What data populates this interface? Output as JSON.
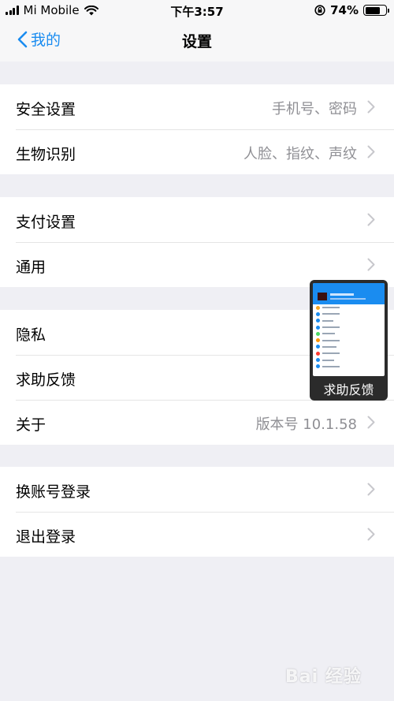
{
  "status_bar": {
    "carrier": "Mi Mobile",
    "time": "下午3:57",
    "battery_percent": "74%",
    "battery_level": 0.74,
    "icons": [
      "signal-bars-icon",
      "wifi-icon",
      "orientation-lock-icon",
      "battery-icon"
    ]
  },
  "nav": {
    "back_label": "我的",
    "title": "设置",
    "accent_color": "#1a8cf0"
  },
  "groups": [
    {
      "rows": [
        {
          "label": "安全设置",
          "value": "手机号、密码"
        },
        {
          "label": "生物识别",
          "value": "人脸、指纹、声纹"
        }
      ]
    },
    {
      "rows": [
        {
          "label": "支付设置",
          "value": ""
        },
        {
          "label": "通用",
          "value": ""
        }
      ]
    },
    {
      "rows": [
        {
          "label": "隐私",
          "value": ""
        },
        {
          "label": "求助反馈",
          "value": ""
        },
        {
          "label": "关于",
          "value": "版本号 10.1.58"
        }
      ]
    },
    {
      "rows": [
        {
          "label": "换账号登录",
          "value": ""
        },
        {
          "label": "退出登录",
          "value": ""
        }
      ]
    }
  ],
  "floating_window": {
    "caption": "求助反馈"
  },
  "watermark": "Bai 经验"
}
